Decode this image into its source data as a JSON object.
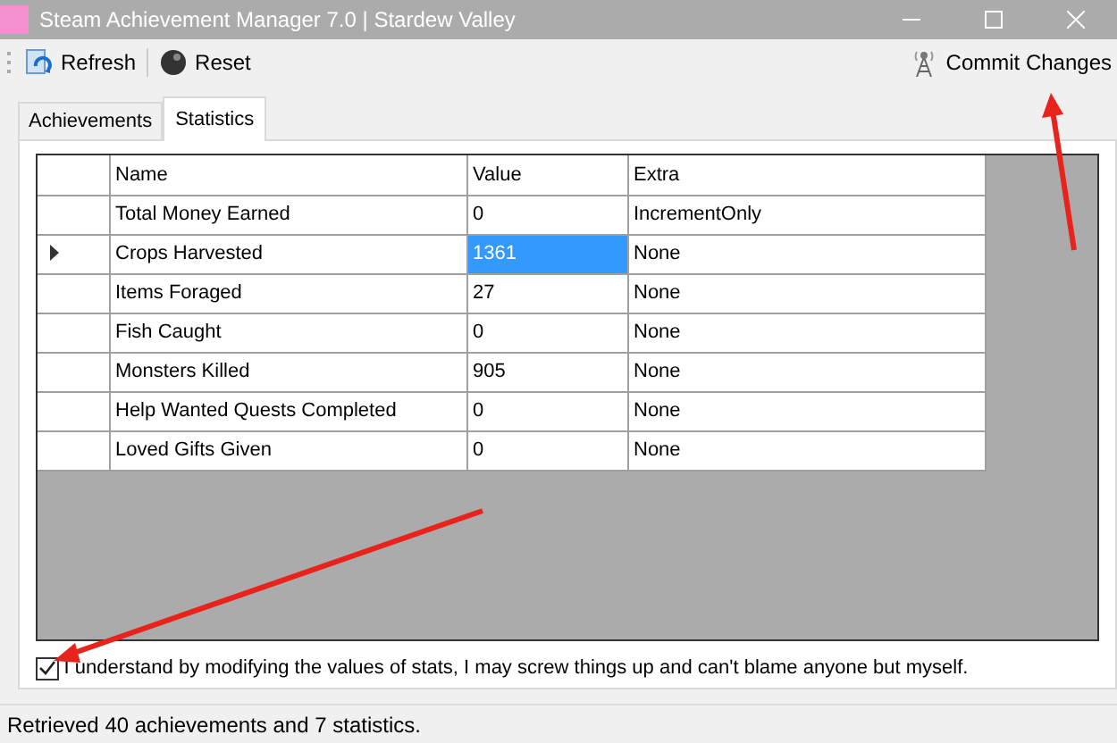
{
  "window": {
    "title": "Steam Achievement Manager 7.0 | Stardew Valley"
  },
  "toolbar": {
    "buttons": [
      {
        "label": "Refresh",
        "kind": "refresh"
      },
      {
        "label": "Reset",
        "kind": "reset"
      }
    ],
    "commit": {
      "label": "Commit Changes"
    }
  },
  "tabs": [
    {
      "label": "Achievements",
      "selected": false
    },
    {
      "label": "Statistics",
      "selected": true
    }
  ],
  "table": {
    "columns": [
      "Name",
      "Value",
      "Extra"
    ],
    "rows": [
      {
        "name": "Total Money Earned",
        "value": "0",
        "extra": "IncrementOnly",
        "selected": false
      },
      {
        "name": "Crops Harvested",
        "value": "1361",
        "extra": "None",
        "selected": true
      },
      {
        "name": "Items Foraged",
        "value": "27",
        "extra": "None",
        "selected": false
      },
      {
        "name": "Fish Caught",
        "value": "0",
        "extra": "None",
        "selected": false
      },
      {
        "name": "Monsters Killed",
        "value": "905",
        "extra": "None",
        "selected": false
      },
      {
        "name": "Help Wanted Quests Completed",
        "value": "0",
        "extra": "None",
        "selected": false
      },
      {
        "name": "Loved Gifts Given",
        "value": "0",
        "extra": "None",
        "selected": false
      }
    ]
  },
  "consent": {
    "label": "I understand by modifying the values of stats, I may screw things up and can't blame anyone but myself.",
    "checked": true
  },
  "status_bar": "Retrieved 40 achievements and 7 statistics."
}
